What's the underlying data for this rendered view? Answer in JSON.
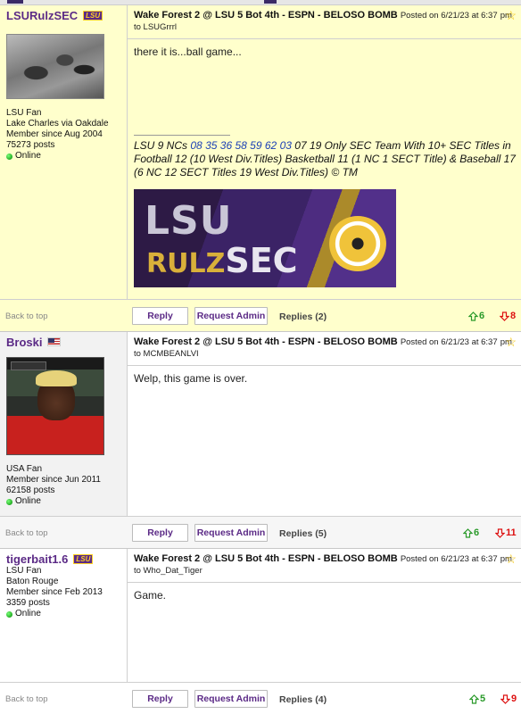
{
  "posts": [
    {
      "username": "LSURulzSEC",
      "badge": "LSU",
      "fan_of": "LSU Fan",
      "location": "Lake Charles via Oakdale",
      "member_since": "Member since Aug 2004",
      "posts": "75273 posts",
      "status": "Online",
      "subject": "Wake Forest 2 @ LSU 5 Bot 4th - ESPN - BELOSO BOMB",
      "posted_line": "Posted on 6/21/23 at 6:37",
      "posted_to": "pm to LSUGrrrl",
      "message": "there it is...ball game...",
      "signature": {
        "prefix": "LSU 9 NCs ",
        "links": [
          "08",
          "35",
          "36",
          "58",
          "59",
          "62",
          "03"
        ],
        "suffix": " 07 19 Only SEC Team With 10+ SEC Titles in Football 12 (10 West Div.Titles) Basketball 11 (1 NC 1 SECT Title) & Baseball 17 (6 NC 12 SECT Titles 19 West Div.Titles) © TM",
        "banner_line1": "LSU",
        "banner_line2a": "RULZ",
        "banner_line2b": "SEC"
      },
      "back_to_top": "Back to top",
      "reply_label": "Reply",
      "admin_label": "Request Admin",
      "replies": "Replies (2)",
      "upvotes": "6",
      "downvotes": "8"
    },
    {
      "username": "Broski",
      "fan_of": "USA Fan",
      "member_since": "Member since Jun 2011",
      "posts": "62158 posts",
      "status": "Online",
      "subject": "Wake Forest 2 @ LSU 5 Bot 4th - ESPN - BELOSO BOMB",
      "posted_line": "Posted on 6/21/23 at 6:37",
      "posted_to": "pm to MCMBEANLVI",
      "message": "Welp, this game is over.",
      "back_to_top": "Back to top",
      "reply_label": "Reply",
      "admin_label": "Request Admin",
      "replies": "Replies (5)",
      "upvotes": "6",
      "downvotes": "11"
    },
    {
      "username": "tigerbait1.6",
      "badge": "LSU",
      "fan_of": "LSU Fan",
      "location": "Baton Rouge",
      "member_since": "Member since Feb 2013",
      "posts": "3359 posts",
      "status": "Online",
      "subject": "Wake Forest 2 @ LSU 5 Bot 4th - ESPN - BELOSO BOMB",
      "posted_line": "Posted on 6/21/23 at 6:37",
      "posted_to": "pm to Who_Dat_Tiger",
      "message": "Game.",
      "back_to_top": "Back to top",
      "reply_label": "Reply",
      "admin_label": "Request Admin",
      "replies": "Replies (4)",
      "upvotes": "5",
      "downvotes": "9"
    }
  ],
  "colors": {
    "username": "#5b2a86",
    "highlight_bg": "#ffffcc",
    "upvote": "#2a9a2a",
    "downvote": "#dd1111",
    "star": "#f2c200"
  },
  "icons": {
    "star": "star-outline-icon",
    "upvote": "thumb-up-arrow-icon",
    "downvote": "thumb-down-arrow-icon",
    "online": "online-dot-icon"
  }
}
